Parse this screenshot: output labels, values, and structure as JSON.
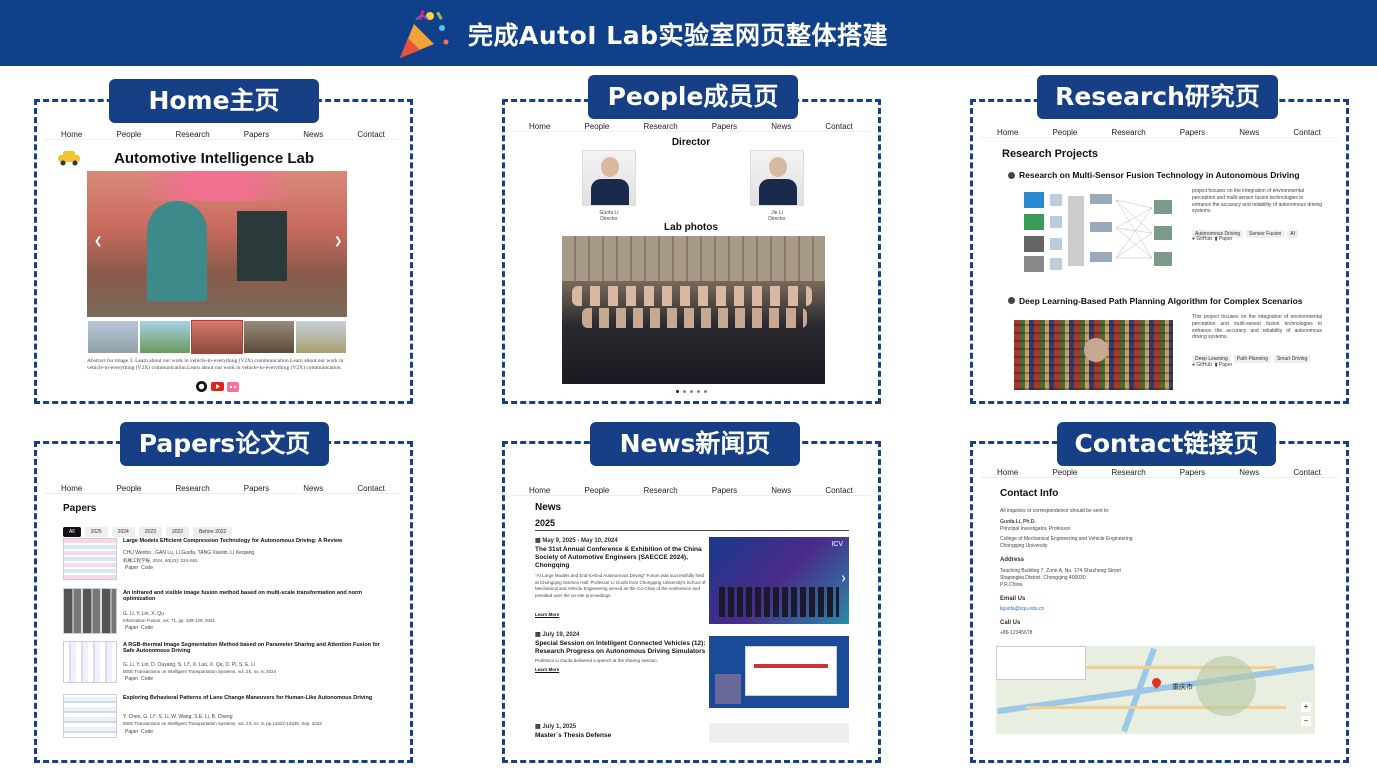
{
  "banner": {
    "title": "完成AutoI Lab实验室网页整体搭建",
    "icon": "party-popper-icon"
  },
  "nav": [
    "Home",
    "People",
    "Research",
    "Papers",
    "News",
    "Contact"
  ],
  "panels": {
    "home": {
      "tag": "Home主页",
      "title": "Automotive Intelligence Lab",
      "caption": "Abstract for image 3. Learn about our work in vehicle-to-everything (V2X) communication.Learn about our work in vehicle-to-everything (V2X) communication.Learn about our work in vehicle-to-everything (V2X) communication.",
      "social": [
        "github-icon",
        "youtube-icon",
        "bilibili-icon"
      ]
    },
    "people": {
      "tag": "People成员页",
      "director": "Director",
      "members": [
        {
          "name": "Guofa Li",
          "role": "Director"
        },
        {
          "name": "Jie Li",
          "role": "Director"
        }
      ],
      "photos": "Lab photos"
    },
    "research": {
      "tag": "Research研究页",
      "heading": "Research Projects",
      "projects": [
        {
          "title": "Research on Multi-Sensor Fusion Technology in Autonomous Driving",
          "desc": "project focuses on the integration of environmental perception and multi-sensor fusion technologies to enhance the accuracy and reliability of autonomous driving systems.",
          "tags": [
            "Autonomous Driving",
            "Sensor Fusion",
            "AI"
          ]
        },
        {
          "title": "Deep Learning-Based Path Planning Algorithm for Complex Scenarios",
          "desc": "This project focuses on the integration of environmental perception and multi-sensor fusion technologies to enhance the accuracy and reliability of autonomous driving systems.",
          "tags": [
            "Deep Learning",
            "Path Planning",
            "Smart Driving"
          ]
        }
      ],
      "links": [
        "GitHub",
        "Paper"
      ]
    },
    "papers": {
      "tag": "Papers论文页",
      "heading": "Papers",
      "filters": [
        "All",
        "2025",
        "2024",
        "2023",
        "2022",
        "Before 2022"
      ],
      "items": [
        {
          "title": "Large Models Efficient Compression Technology for Autonomous Driving: A Review",
          "authors": "CHU Wenbo , GAN Lu, LI Guofa, TANG Xiaolin, LI Keqiang",
          "venue": "机械工程学报, 2024, 60(22): 224-240."
        },
        {
          "title": "An infrared and visible image fusion method based on multi-scale transformation and norm optimization",
          "authors": "G. Li, Y. Lin, X. Qu",
          "venue": "Information Fusion, vol. 71, pp. 109-129, 2021"
        },
        {
          "title": "A RGB-thermal Image Segmentation Method based on Parameter Sharing and Attention Fusion for Safe Autonomous Driving",
          "authors": "G. Li, Y. Lin, D. Ouyang, S. Li*, X. Luo, X. Qu, D. Pi, S. E. Li",
          "venue": "IEEE Transactions on Intelligent Transportation Systems, vol. 25, no. 6, 2024"
        },
        {
          "title": "Exploring Behavioral Patterns of Lane Change Maneuvers for Human-Like Autonomous Driving",
          "authors": "Y. Chen, G. Li*, S. Li, W. Wang, S.E. Li, B. Cheng",
          "venue": "IEEE Transactions on Intelligent Transportation Systems, vol. 23, no. 9, pp.14322-14335, Sep. 2022"
        }
      ],
      "links": [
        "Paper",
        "Code"
      ]
    },
    "news": {
      "tag": "News新闻页",
      "heading": "News",
      "year": "2025",
      "items": [
        {
          "date": "May 9, 2025 - May 10, 2024",
          "title": "The 31st Annual Conference & Exhibition of the China Society of Automotive Engineers (SAECCE 2024), Chongqing",
          "body": "\"AI Large Models and End-to-End Autonomous Driving\" Forum was successfully held at Chongqing Science Hall. Professor Li Guofa from Chongqing University's School of Mechanical and Vehicle Engineering served as the Co-Chair of the conference and presided over the on-site proceedings.",
          "more": "Learn More"
        },
        {
          "date": "July 19, 2024",
          "title": "Special Session on Intelligent Connected Vehicles (12): Research Progress on Autonomous Driving Simulators",
          "body": "Professor Li Guofa delivered a speech at the sharing session.",
          "more": "Learn More"
        },
        {
          "date": "July 1, 2025",
          "title": "Master`s Thesis Defense",
          "body": "",
          "more": ""
        }
      ]
    },
    "contact": {
      "tag": "Contact链接页",
      "heading": "Contact Info",
      "intro": "All inquiries or correspondence should be sent to:",
      "name": "Guofa Li, Ph.D.",
      "title": "Principal Investigator, Professor",
      "dept": "College of Mechanical Engineering and Vehicle Engineering",
      "univ": "Chongqing University",
      "addr_h": "Address",
      "addr": [
        "Teaching Building 7, Zone A, No. 174 Shazheng Street",
        "Shapingba District, Chongqing 400030",
        "P.R.China"
      ],
      "email_h": "Email Us",
      "email": "liguofa@cqu.edu.cn",
      "call_h": "Call Us",
      "phone": "+86-12345678",
      "map_label": "重庆市"
    }
  }
}
